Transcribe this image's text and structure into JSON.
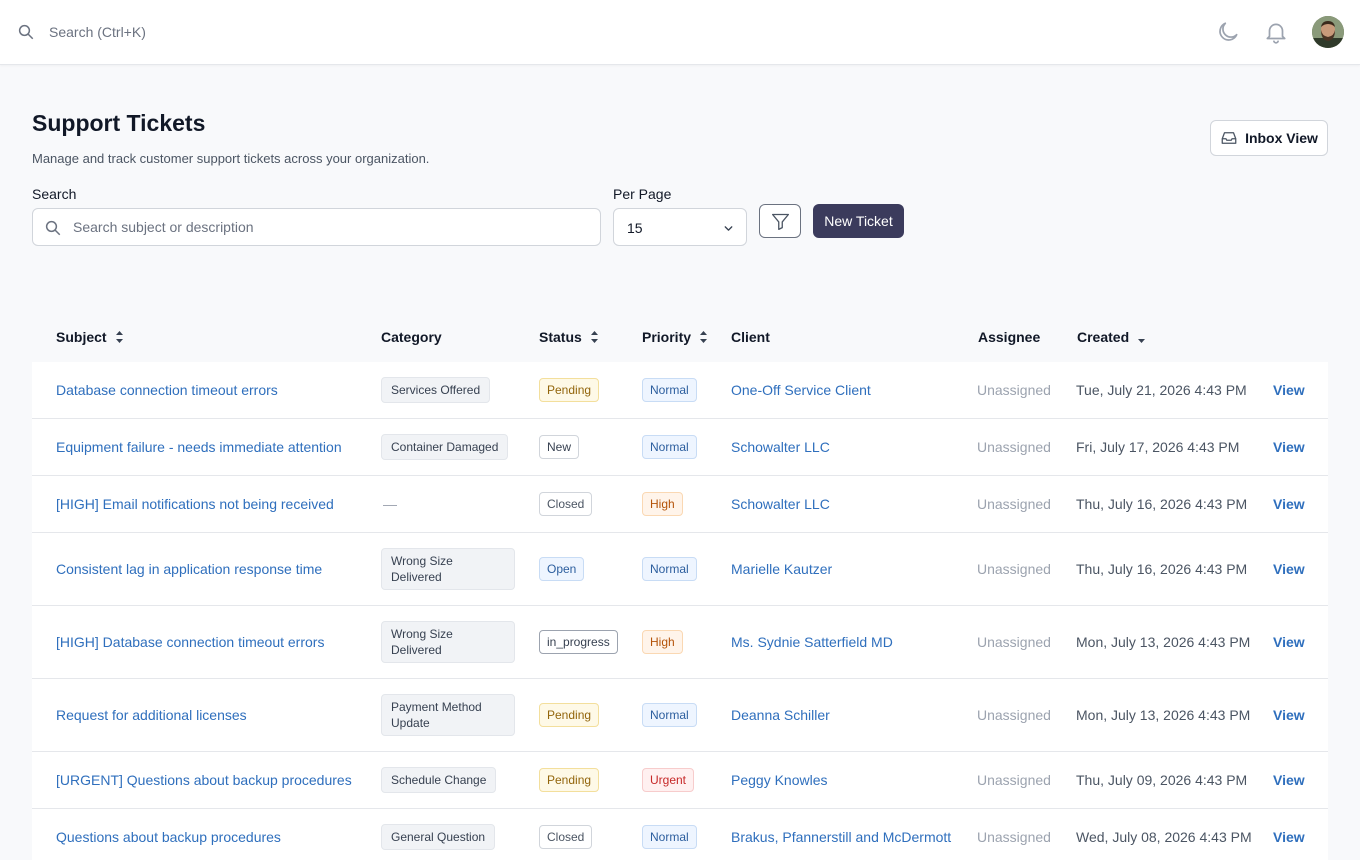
{
  "topbar": {
    "search_label": "Search (Ctrl+K)",
    "icons": [
      "search-icon",
      "moon-icon",
      "bell-icon",
      "user-avatar"
    ]
  },
  "page": {
    "title": "Support Tickets",
    "subtitle": "Manage and track customer support tickets across your organization.",
    "inbox_view_label": "Inbox View"
  },
  "filters": {
    "search_label": "Search",
    "search_placeholder": "Search subject or description",
    "per_page_label": "Per Page",
    "per_page_value": "15",
    "new_ticket_label": "New Ticket"
  },
  "table": {
    "columns": [
      "Subject",
      "Category",
      "Status",
      "Priority",
      "Client",
      "Assignee",
      "Created"
    ],
    "view_label": "View",
    "rows": [
      {
        "subject": "Database connection timeout errors",
        "category": "Services Offered",
        "status": "Pending",
        "priority": "Normal",
        "client": "One-Off Service Client",
        "assignee": "Unassigned",
        "created": "Tue, July 21, 2026 4:43 PM"
      },
      {
        "subject": "Equipment failure - needs immediate attention",
        "category": "Container Damaged",
        "status": "New",
        "priority": "Normal",
        "client": "Schowalter LLC",
        "assignee": "Unassigned",
        "created": "Fri, July 17, 2026 4:43 PM"
      },
      {
        "subject": "[HIGH] Email notifications not being received",
        "category": "—",
        "status": "Closed",
        "priority": "High",
        "client": "Schowalter LLC",
        "assignee": "Unassigned",
        "created": "Thu, July 16, 2026 4:43 PM"
      },
      {
        "subject": "Consistent lag in application response time",
        "category": "Wrong Size Delivered",
        "status": "Open",
        "priority": "Normal",
        "client": "Marielle Kautzer",
        "assignee": "Unassigned",
        "created": "Thu, July 16, 2026 4:43 PM"
      },
      {
        "subject": "[HIGH] Database connection timeout errors",
        "category": "Wrong Size Delivered",
        "status": "in_progress",
        "priority": "High",
        "client": "Ms. Sydnie Satterfield MD",
        "assignee": "Unassigned",
        "created": "Mon, July 13, 2026 4:43 PM"
      },
      {
        "subject": "Request for additional licenses",
        "category": "Payment Method Update",
        "status": "Pending",
        "priority": "Normal",
        "client": "Deanna Schiller",
        "assignee": "Unassigned",
        "created": "Mon, July 13, 2026 4:43 PM"
      },
      {
        "subject": "[URGENT] Questions about backup procedures",
        "category": "Schedule Change",
        "status": "Pending",
        "priority": "Urgent",
        "client": "Peggy Knowles",
        "assignee": "Unassigned",
        "created": "Thu, July 09, 2026 4:43 PM"
      },
      {
        "subject": "Questions about backup procedures",
        "category": "General Question",
        "status": "Closed",
        "priority": "Normal",
        "client": "Brakus, Pfannerstill and McDermott",
        "assignee": "Unassigned",
        "created": "Wed, July 08, 2026 4:43 PM"
      }
    ]
  },
  "colors": {
    "link": "#2f6fbd",
    "primary_button": "#3b3b5c",
    "pending": "#92650c",
    "high": "#b45309",
    "urgent": "#c62828",
    "normal": "#2c5e9e"
  }
}
